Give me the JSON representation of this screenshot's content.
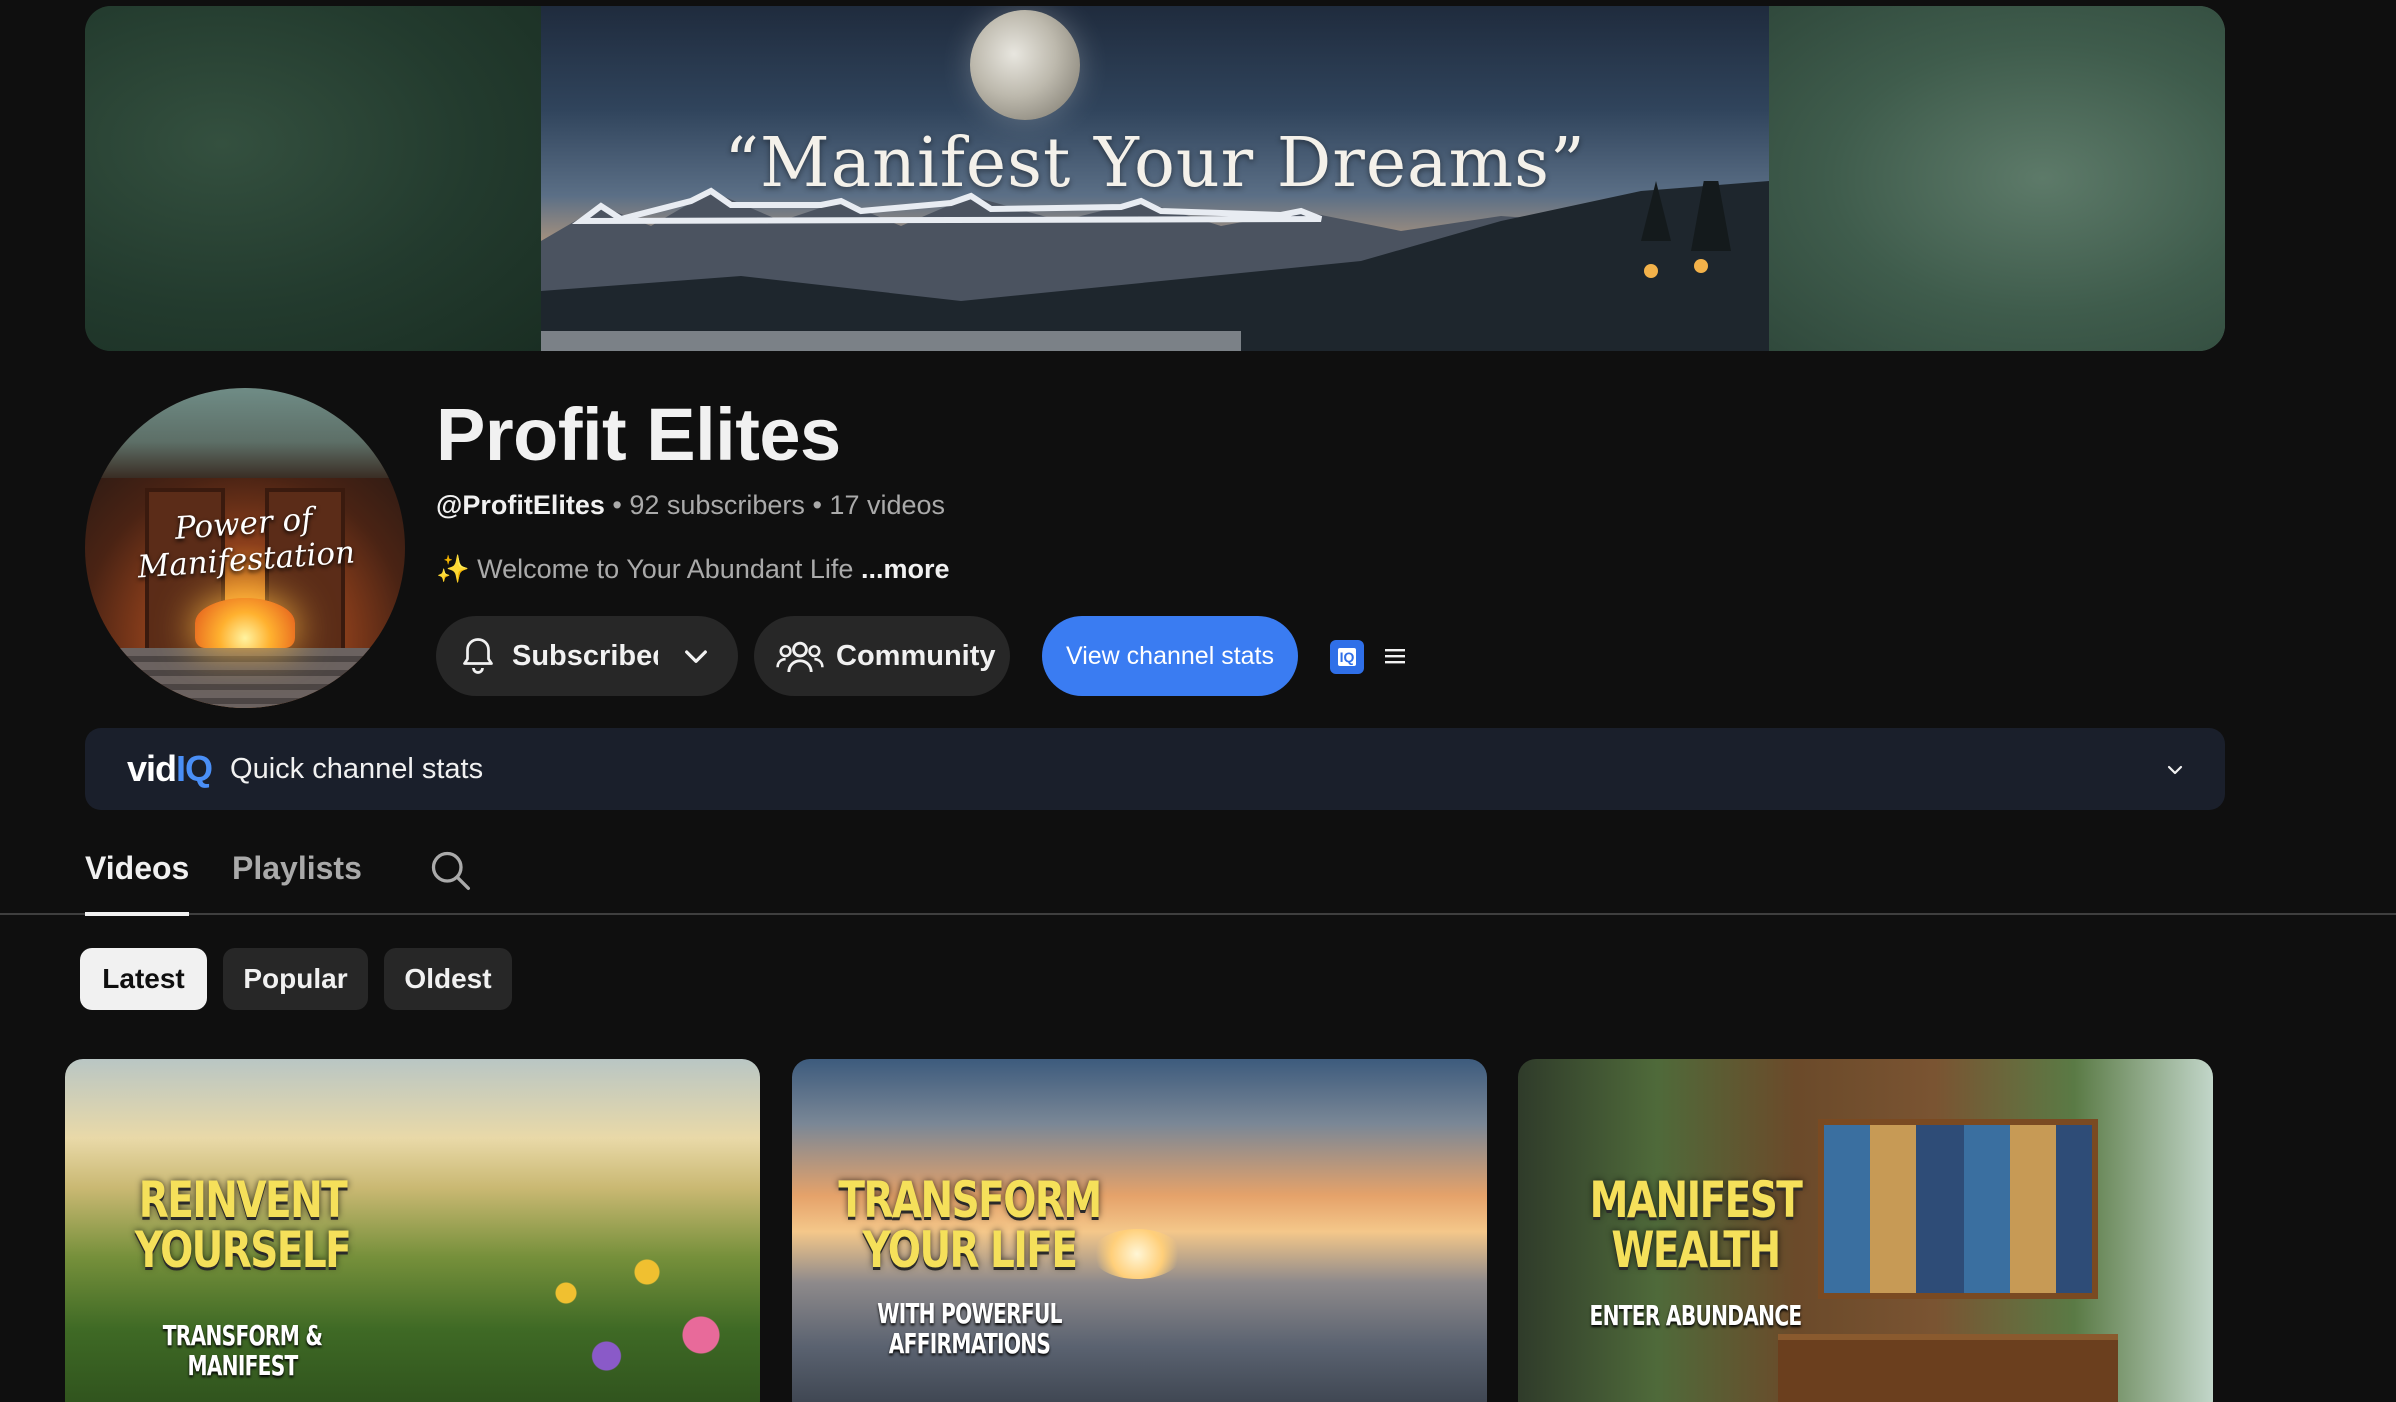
{
  "banner": {
    "slogan": "“Manifest Your Dreams”"
  },
  "avatar": {
    "script_text": "Power of Manifestation"
  },
  "channel": {
    "name": "Profit Elites",
    "handle": "@ProfitElites",
    "separator": "•",
    "subscribers": "92 subscribers",
    "videos": "17 videos",
    "description_emoji": "✨",
    "description": "Welcome to Your Abundant Life",
    "more_label": "...more"
  },
  "actions": {
    "subscribe_label": "Subscribed",
    "community_label": "Community",
    "stats_label": "View channel stats",
    "iq_badge": "IQ"
  },
  "vidiq": {
    "logo_vid": "vid",
    "logo_iq": "IQ",
    "label": "Quick channel stats"
  },
  "tabs": [
    {
      "label": "Videos",
      "active": true
    },
    {
      "label": "Playlists",
      "active": false
    }
  ],
  "filters": [
    {
      "label": "Latest",
      "selected": true
    },
    {
      "label": "Popular",
      "selected": false
    },
    {
      "label": "Oldest",
      "selected": false
    }
  ],
  "videos": [
    {
      "title_line1": "REINVENT",
      "title_line2": "YOURSELF",
      "sub_line1": "TRANSFORM &",
      "sub_line2": "MANIFEST"
    },
    {
      "title_line1": "TRANSFORM",
      "title_line2": "YOUR LIFE",
      "sub_line1": "WITH POWERFUL",
      "sub_line2": "AFFIRMATIONS"
    },
    {
      "title_line1": "MANIFEST",
      "title_line2": "WEALTH",
      "sub_line1": "ENTER ABUNDANCE",
      "sub_line2": ""
    }
  ],
  "colors": {
    "background": "#0f0f0f",
    "accent_blue": "#3a7cf2",
    "chip_bg": "#272727",
    "thumb_title": "#f5e05a"
  }
}
